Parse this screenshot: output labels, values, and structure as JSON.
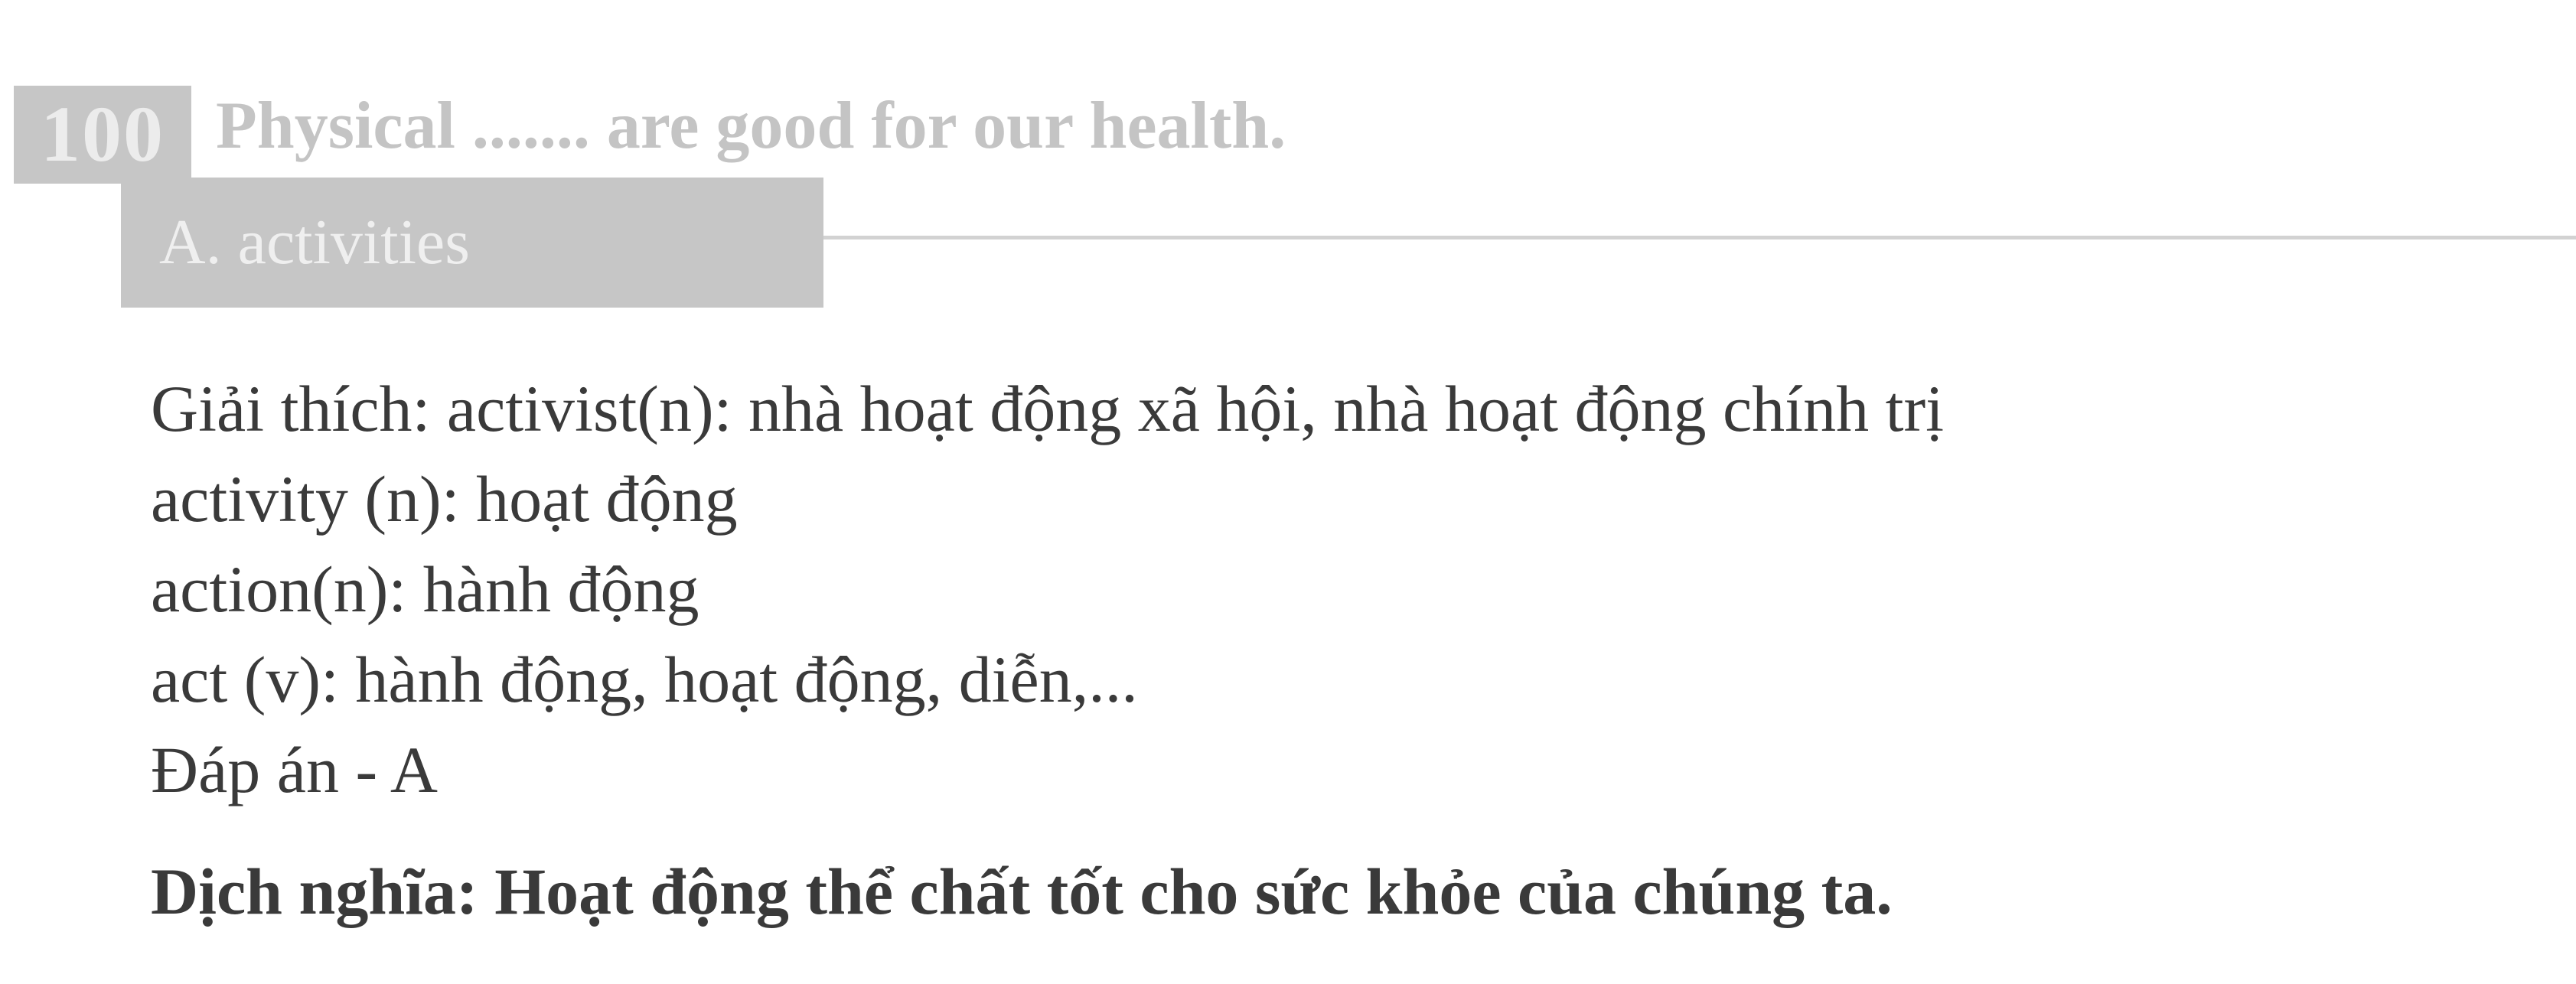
{
  "question": {
    "number": "100",
    "text": "Physical ....... are good for our health."
  },
  "answer": {
    "label": "A. activities"
  },
  "explanation": {
    "lines": [
      "Giải thích: activist(n): nhà hoạt động xã hội, nhà hoạt động chính trị",
      "activity (n): hoạt động",
      "action(n): hành động",
      "act (v): hành động, hoạt động, diễn,...",
      "Đáp án - A"
    ]
  },
  "translation": "Dịch nghĩa: Hoạt động thể chất tốt cho sức khỏe của chúng ta.",
  "colors": {
    "header_box": "#c6c6c6",
    "header_text": "#c4c4c4",
    "body_text": "#3a3a3a"
  }
}
